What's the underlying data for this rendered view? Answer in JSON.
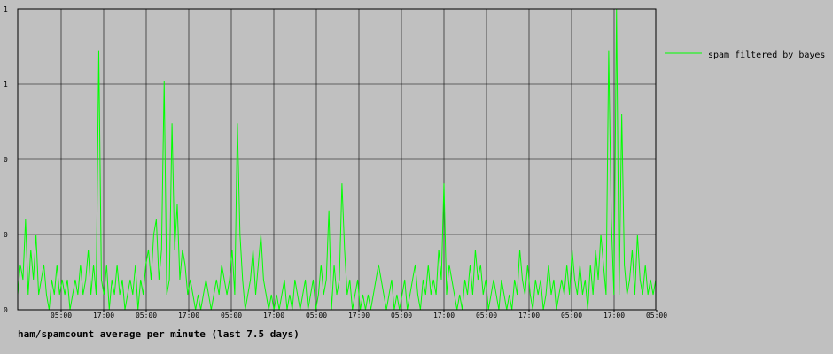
{
  "chart_data": {
    "type": "line",
    "title": "ham/spamcount average per minute (last 7.5 days)",
    "x_tick_labels": [
      "05:00",
      "17:00",
      "05:00",
      "17:00",
      "05:00",
      "17:00",
      "05:00",
      "17:00",
      "05:00",
      "17:00",
      "05:00",
      "17:00",
      "05:00",
      "17:00",
      "05:00"
    ],
    "y_tick_labels": [
      "1",
      "1",
      "0",
      "0",
      "0"
    ],
    "grid": true,
    "legend_placement": "right",
    "series": [
      {
        "name": "spam filtered by bayes",
        "color": "#00ff00",
        "values": [
          0.05,
          0.15,
          0.1,
          0.3,
          0.05,
          0.2,
          0.1,
          0.25,
          0.05,
          0.1,
          0.15,
          0.05,
          0.0,
          0.1,
          0.05,
          0.15,
          0.05,
          0.1,
          0.05,
          0.1,
          0.0,
          0.05,
          0.1,
          0.05,
          0.15,
          0.05,
          0.1,
          0.2,
          0.05,
          0.15,
          0.05,
          0.86,
          0.1,
          0.05,
          0.15,
          0.0,
          0.1,
          0.05,
          0.15,
          0.05,
          0.1,
          0.0,
          0.05,
          0.1,
          0.05,
          0.15,
          0.0,
          0.1,
          0.05,
          0.15,
          0.2,
          0.1,
          0.25,
          0.3,
          0.1,
          0.2,
          0.76,
          0.05,
          0.1,
          0.62,
          0.2,
          0.35,
          0.1,
          0.2,
          0.15,
          0.05,
          0.1,
          0.05,
          0.0,
          0.05,
          0.0,
          0.05,
          0.1,
          0.05,
          0.0,
          0.05,
          0.1,
          0.05,
          0.15,
          0.1,
          0.05,
          0.1,
          0.2,
          0.05,
          0.62,
          0.25,
          0.1,
          0.0,
          0.05,
          0.1,
          0.2,
          0.05,
          0.15,
          0.25,
          0.1,
          0.05,
          0.0,
          0.05,
          0.0,
          0.05,
          0.0,
          0.05,
          0.1,
          0.0,
          0.05,
          0.0,
          0.1,
          0.05,
          0.0,
          0.05,
          0.1,
          0.0,
          0.05,
          0.1,
          0.0,
          0.05,
          0.15,
          0.05,
          0.1,
          0.33,
          0.0,
          0.15,
          0.05,
          0.1,
          0.42,
          0.2,
          0.05,
          0.1,
          0.0,
          0.05,
          0.1,
          0.0,
          0.05,
          0.0,
          0.05,
          0.0,
          0.05,
          0.1,
          0.15,
          0.1,
          0.05,
          0.0,
          0.05,
          0.1,
          0.0,
          0.05,
          0.0,
          0.05,
          0.1,
          0.0,
          0.05,
          0.1,
          0.15,
          0.05,
          0.0,
          0.1,
          0.05,
          0.15,
          0.05,
          0.1,
          0.05,
          0.2,
          0.1,
          0.42,
          0.05,
          0.15,
          0.1,
          0.05,
          0.0,
          0.05,
          0.0,
          0.1,
          0.05,
          0.15,
          0.05,
          0.2,
          0.1,
          0.15,
          0.05,
          0.1,
          0.0,
          0.05,
          0.1,
          0.05,
          0.0,
          0.1,
          0.05,
          0.0,
          0.05,
          0.0,
          0.1,
          0.05,
          0.2,
          0.1,
          0.05,
          0.15,
          0.05,
          0.0,
          0.1,
          0.05,
          0.1,
          0.0,
          0.05,
          0.15,
          0.05,
          0.1,
          0.0,
          0.05,
          0.1,
          0.05,
          0.15,
          0.05,
          0.2,
          0.1,
          0.05,
          0.15,
          0.05,
          0.1,
          0.0,
          0.15,
          0.05,
          0.2,
          0.1,
          0.25,
          0.15,
          0.05,
          0.86,
          0.3,
          0.05,
          1.0,
          0.05,
          0.65,
          0.15,
          0.05,
          0.1,
          0.2,
          0.05,
          0.25,
          0.1,
          0.05,
          0.15,
          0.05,
          0.1,
          0.05,
          0.1
        ]
      }
    ],
    "ylim": [
      0,
      1
    ]
  }
}
